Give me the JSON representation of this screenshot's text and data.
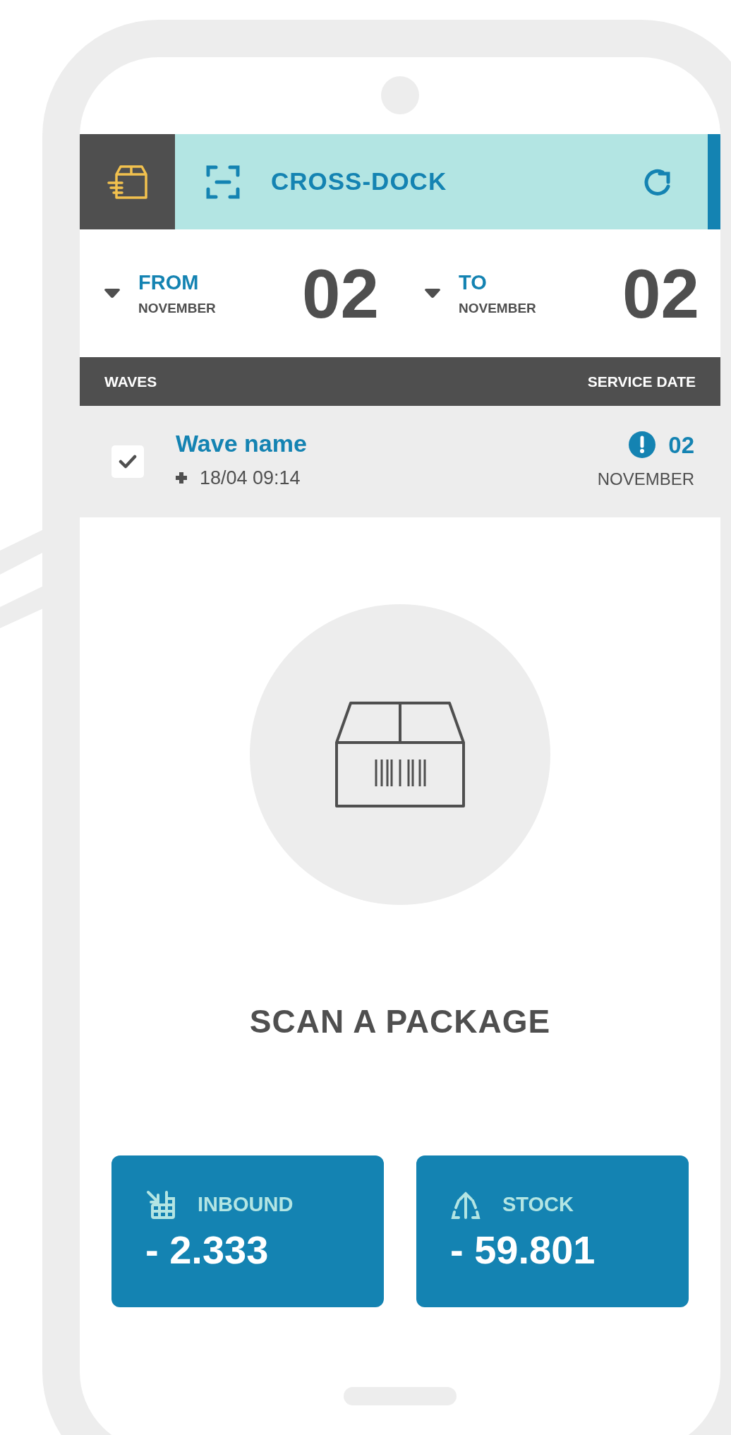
{
  "header": {
    "title": "CROSS-DOCK"
  },
  "range": [
    {
      "label": "FROM",
      "month": "NOVEMBER",
      "day": "02"
    },
    {
      "label": "TO",
      "month": "NOVEMBER",
      "day": "02"
    }
  ],
  "table": {
    "columns": [
      "WAVES",
      "SERVICE DATE"
    ],
    "rows": [
      {
        "name": "Wave name",
        "time": "18/04 09:14",
        "checked": true,
        "warning": true,
        "day": "02",
        "month": "NOVEMBER"
      }
    ]
  },
  "prompt": "SCAN A PACKAGE",
  "counters": [
    {
      "kind": "inbound",
      "label": "INBOUND",
      "value": "- 2.333"
    },
    {
      "kind": "stock",
      "label": "STOCK",
      "value": "- 59.801"
    }
  ]
}
